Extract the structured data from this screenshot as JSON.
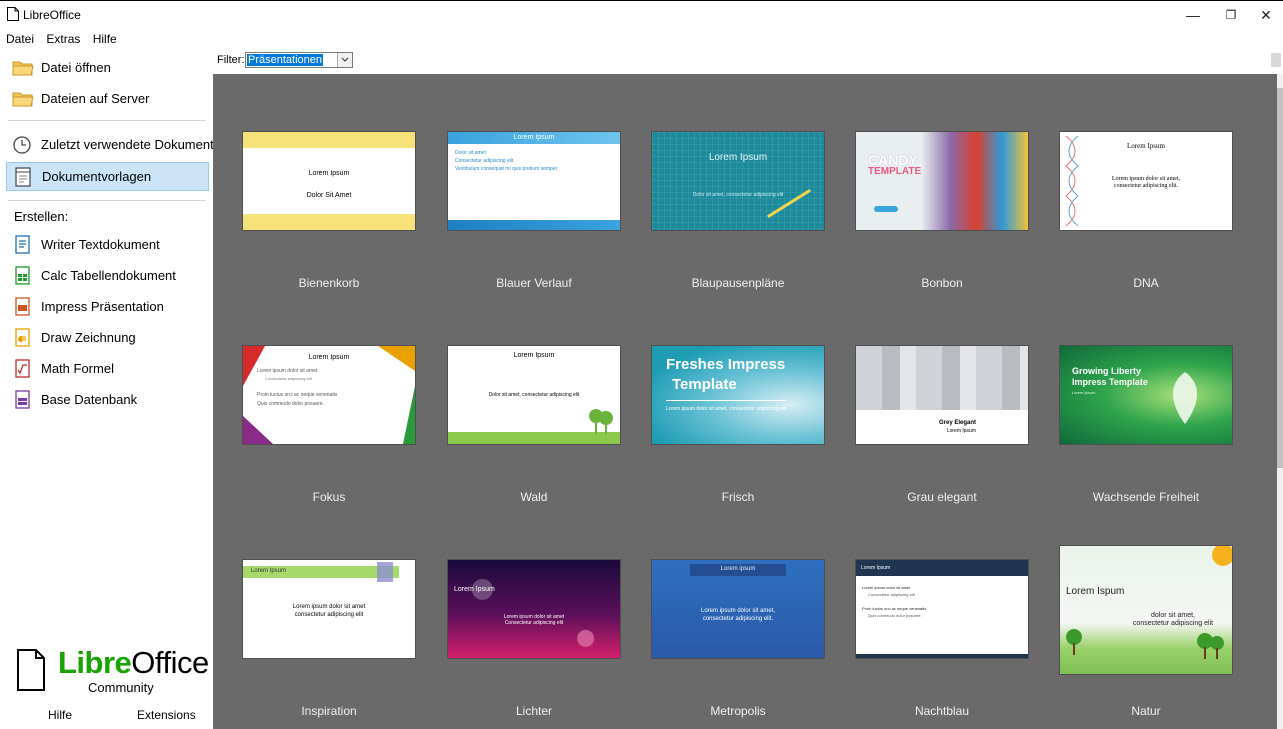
{
  "window": {
    "title": "LibreOffice",
    "minimize": "—",
    "restore": "❐",
    "close": "✕"
  },
  "menu": [
    "Datei",
    "Extras",
    "Hilfe"
  ],
  "sidebar": {
    "open_file": "Datei öffnen",
    "remote_files": "Dateien auf Server",
    "recent_docs": "Zuletzt verwendete Dokumente",
    "templates": "Dokumentvorlagen",
    "create_heading": "Erstellen:",
    "create": [
      {
        "label": "Writer Textdokument",
        "icon": "writer-icon",
        "color": "#1e6fb8"
      },
      {
        "label": "Calc Tabellendokument",
        "icon": "calc-icon",
        "color": "#1e9a2a"
      },
      {
        "label": "Impress Präsentation",
        "icon": "impress-icon",
        "color": "#d0541c"
      },
      {
        "label": "Draw Zeichnung",
        "icon": "draw-icon",
        "color": "#e8a100"
      },
      {
        "label": "Math Formel",
        "icon": "math-icon",
        "color": "#c22b2b"
      },
      {
        "label": "Base Datenbank",
        "icon": "base-icon",
        "color": "#7a3ca0"
      }
    ],
    "logo": {
      "libre": "Libre",
      "office": "Office",
      "sub": "Community"
    },
    "help": "Hilfe",
    "extensions": "Extensions"
  },
  "filter": {
    "label": "Filter:",
    "value": "Präsentationen"
  },
  "templates": [
    {
      "name": "Bienenkorb",
      "thumb": {
        "t1": "Lorem Ipsum",
        "t2": "Dolor Sit Amet"
      }
    },
    {
      "name": "Blauer Verlauf",
      "thumb": {
        "t1": "Lorem Ipsum",
        "b1": "Dolor sit amet",
        "b2": "Consectetur adipiscing elit",
        "b3": "Vestibulum consequat mi quis pretium semper"
      }
    },
    {
      "name": "Blaupausenpläne",
      "thumb": {
        "t1": "Lorem Ipsum",
        "t2": "Dolor sit amet, consectetur adipiscing elit"
      }
    },
    {
      "name": "Bonbon",
      "thumb": {
        "t1": "CANDY",
        "t2": "TEMPLATE"
      }
    },
    {
      "name": "DNA",
      "thumb": {
        "t1": "Lorem Ipsum",
        "t2": "Lorem ipsum dolor sit amet,",
        "t3": "consectetur adipiscing elit."
      }
    },
    {
      "name": "Fokus",
      "thumb": {
        "t1": "Lorem Ipsum",
        "b1": "Lorem ipsum dolor sit amet",
        "b2": "Consectetur adipiscing elit",
        "b3": "Proin luctus orci ac neque venenatis",
        "b4": "Quis commodo dolor posuere."
      }
    },
    {
      "name": "Wald",
      "thumb": {
        "t1": "Lorem Ipsum",
        "t2": "Dolor sit amet, consectetur adipiscing elit"
      }
    },
    {
      "name": "Frisch",
      "thumb": {
        "t1": "Freshes Impress",
        "t2": "Template",
        "t3": "Lorem ipsum dolor sit amet, consectetur adipiscing elit"
      }
    },
    {
      "name": "Grau elegant",
      "thumb": {
        "t1": "Grey Elegant",
        "t2": "Lorem Ipsum"
      }
    },
    {
      "name": "Wachsende Freiheit",
      "thumb": {
        "t1": "Growing Liberty",
        "t2": "Impress Template",
        "t3": "Lorem Ipsum"
      }
    },
    {
      "name": "Inspiration",
      "thumb": {
        "t1": "Lorem Ipsum",
        "t2": "Lorem ipsum dolor sit amet",
        "t3": "consectetur adipiscing elit"
      }
    },
    {
      "name": "Lichter",
      "thumb": {
        "t1": "Lorem Ipsum",
        "t2": "Lorem ipsum dolor sit amet",
        "t3": "Consectetur adipiscing elit"
      }
    },
    {
      "name": "Metropolis",
      "thumb": {
        "t1": "Lorem ipsum",
        "t2": "Lorem ipsum dolor sit amet,",
        "t3": "consectetur adipiscing elit."
      }
    },
    {
      "name": "Nachtblau",
      "thumb": {
        "t1": "Lorem Ipsum",
        "b1": "Lorem ipsum dolor sit amet",
        "b2": "Consectetur adipiscing elit",
        "b3": "Proin luctus orci ac neque venenatis",
        "b4": "Quis commodo dolor posuere."
      }
    },
    {
      "name": "Natur",
      "thumb": {
        "t1": "Lorem Ispum",
        "t2": "dolor sit amet,",
        "t3": "consectetur adipiscing elit"
      }
    }
  ]
}
